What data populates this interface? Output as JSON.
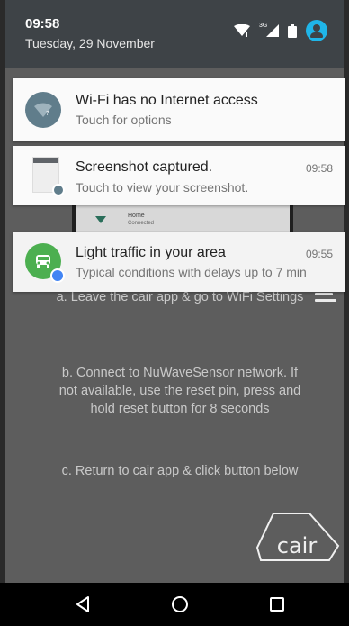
{
  "status_bar": {
    "time": "09:58",
    "date": "Tuesday, 29 November",
    "network_type": "3G",
    "icons": [
      "wifi-icon",
      "signal-icon",
      "battery-icon",
      "account-icon"
    ]
  },
  "notifications": [
    {
      "app_icon": "wifi-icon",
      "title": "Wi-Fi has no Internet access",
      "text": "Touch for options",
      "time": ""
    },
    {
      "app_icon": "screenshot-icon",
      "title": "Screenshot captured.",
      "text": "Touch to view your screenshot.",
      "time": "09:58"
    },
    {
      "app_icon": "car-icon",
      "title": "Light traffic in your area",
      "text": "Typical conditions with delays up to 7 min",
      "time": "09:55"
    }
  ],
  "preview_peek": {
    "line1": "Home",
    "line2": "Connected"
  },
  "app": {
    "instruction_a": "a. Leave the cair app & go to WiFi Settings",
    "instruction_b": "b. Connect to NuWaveSensor network. If not available, use the reset pin, press and hold reset button for 8 seconds",
    "instruction_c": "c. Return to cair app & click button below",
    "logo_text": "cair"
  },
  "navigation": {
    "buttons": [
      "back-icon",
      "home-icon",
      "recents-icon"
    ]
  },
  "colors": {
    "shade_header": "#3e4347",
    "accent_account": "#1fb5e8",
    "wifi_icon_bg": "#607d8b",
    "traffic_icon_bg": "#4caf50"
  }
}
